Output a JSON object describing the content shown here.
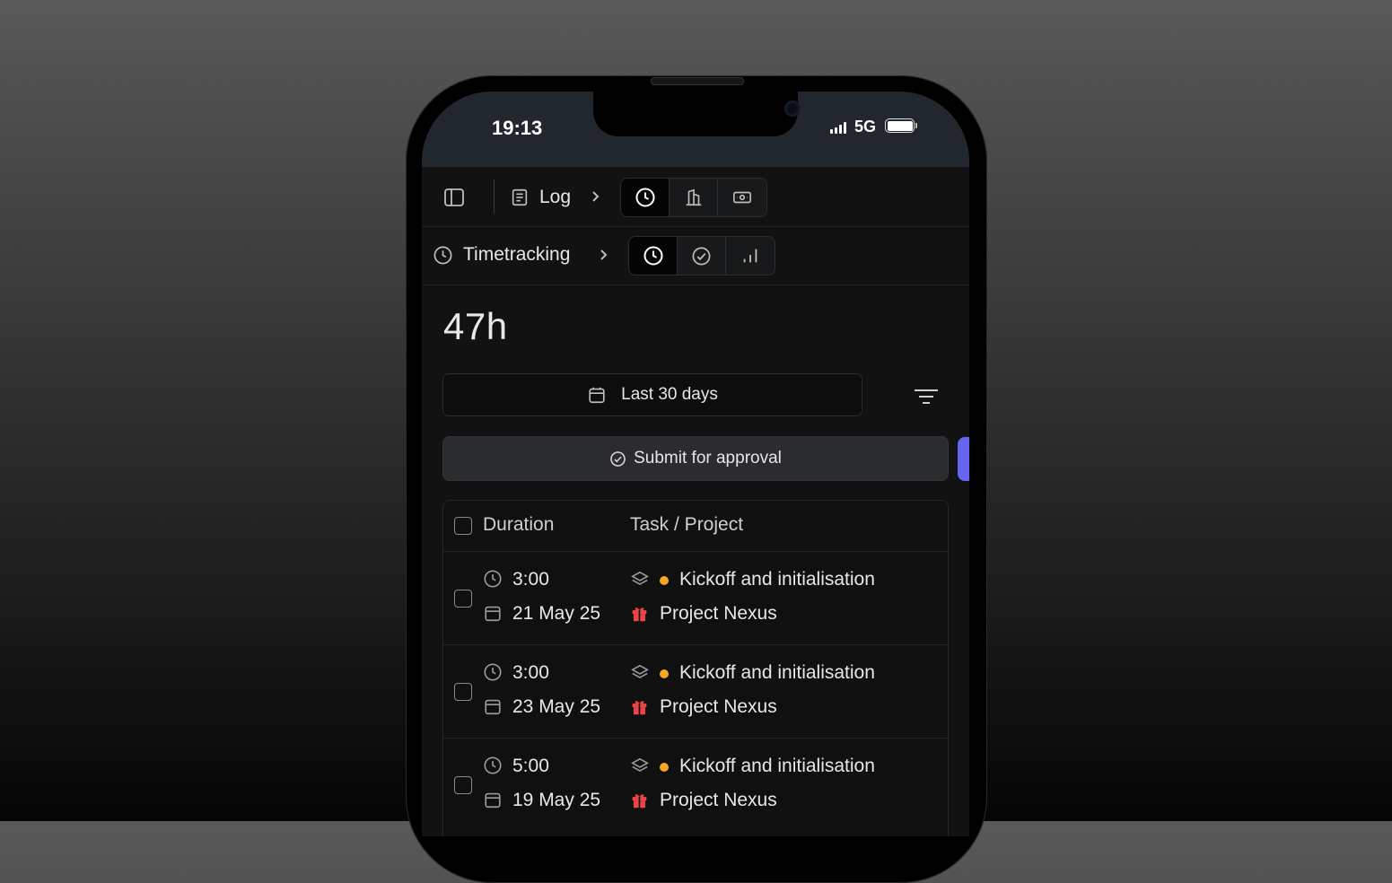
{
  "status_bar": {
    "time": "19:13",
    "network": "5G"
  },
  "nav": {
    "breadcrumb1_label": "Log",
    "breadcrumb1_segments": [
      "clock-icon",
      "building-icon",
      "banknote-icon"
    ],
    "breadcrumb2_label": "Timetracking",
    "breadcrumb2_segments": [
      "clock-icon",
      "check-circle-icon",
      "bar-chart-icon"
    ]
  },
  "summary": {
    "total": "47h"
  },
  "filters": {
    "date_range": "Last 30 days"
  },
  "actions": {
    "submit_label": "Submit for approval"
  },
  "table": {
    "columns": [
      "Duration",
      "Task / Project"
    ],
    "rows": [
      {
        "duration": "3:00",
        "date": "21 May 25",
        "task": "Kickoff and initialisation",
        "project": "Project Nexus"
      },
      {
        "duration": "3:00",
        "date": "23 May 25",
        "task": "Kickoff and initialisation",
        "project": "Project Nexus"
      },
      {
        "duration": "5:00",
        "date": "19 May 25",
        "task": "Kickoff and initialisation",
        "project": "Project Nexus"
      }
    ]
  },
  "colors": {
    "accent": "#6565f0",
    "task_dot": "#f5a623",
    "project_icon": "#ef4444"
  }
}
